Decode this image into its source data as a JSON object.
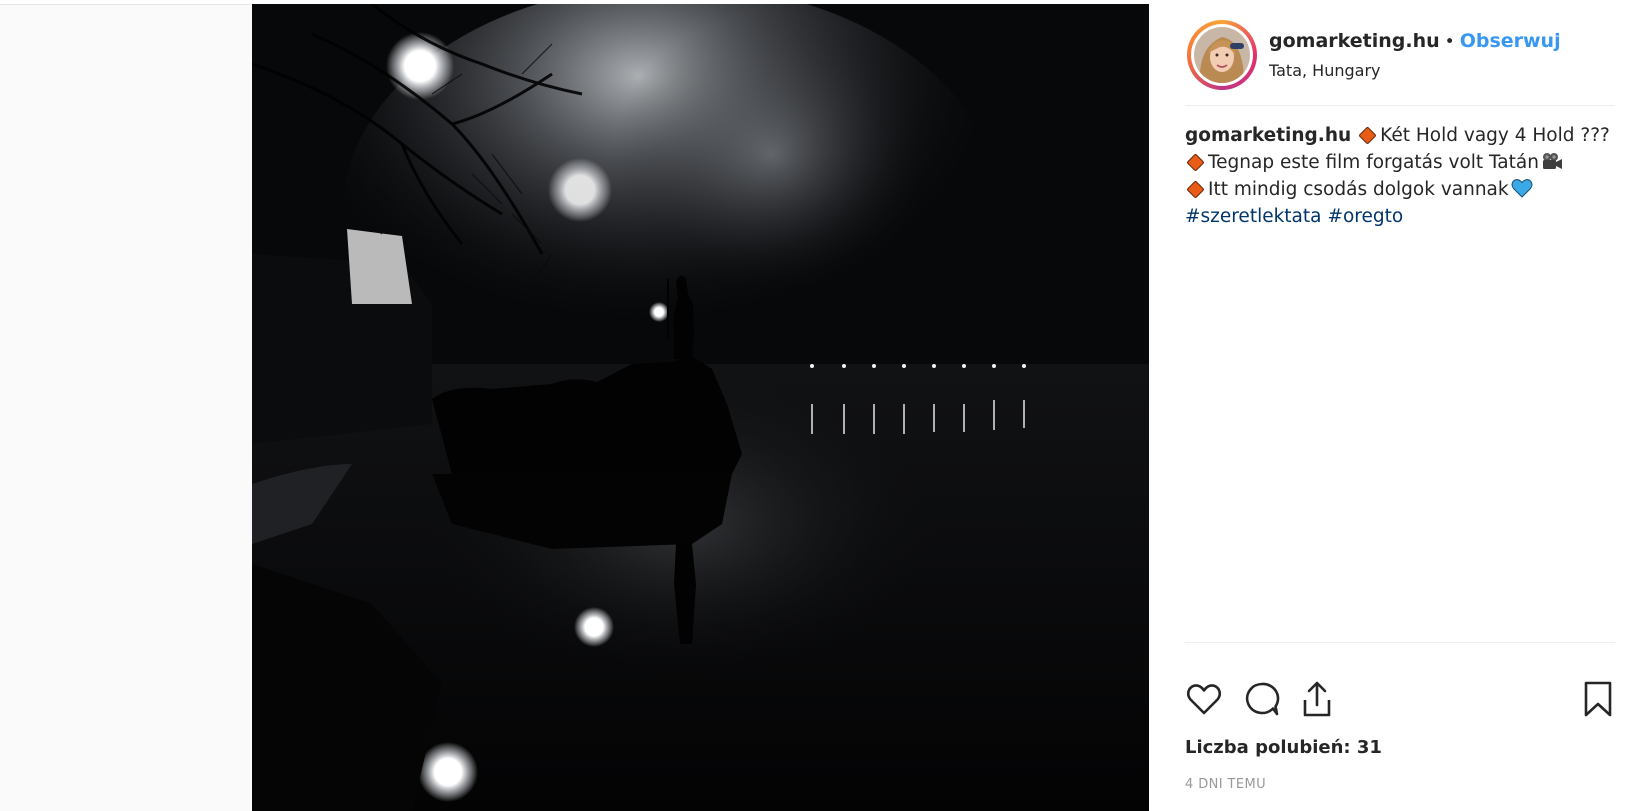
{
  "post": {
    "username": "gomarketing.hu",
    "separator": "•",
    "follow_label": "Obserwuj",
    "location": "Tata, Hungary",
    "image_alt": "Night photo of a statue on a rock by a foggy lake with lights reflecting in the water"
  },
  "caption": {
    "username": "gomarketing.hu",
    "line1_text": "Két Hold vagy 4 Hold ???",
    "line2_text": "Tegnap este film forgatás volt Tatán",
    "line3_text": "Itt mindig csodás dolgok vannak",
    "hashtags": [
      "#szeretlektata",
      "#oregto"
    ],
    "emoji": {
      "diamond": "orange-diamond",
      "camera": "movie-camera",
      "heart": "blue-heart"
    }
  },
  "actions": {
    "like_icon": "heart-icon",
    "comment_icon": "comment-icon",
    "share_icon": "share-icon",
    "save_icon": "bookmark-icon"
  },
  "likes_label": "Liczba polubień: 31",
  "timestamp": "4 DNI TEMU",
  "colors": {
    "accent": "#3897f0",
    "text": "#262626",
    "hashtag": "#003569",
    "muted": "#999999",
    "background": "#fafafa"
  }
}
